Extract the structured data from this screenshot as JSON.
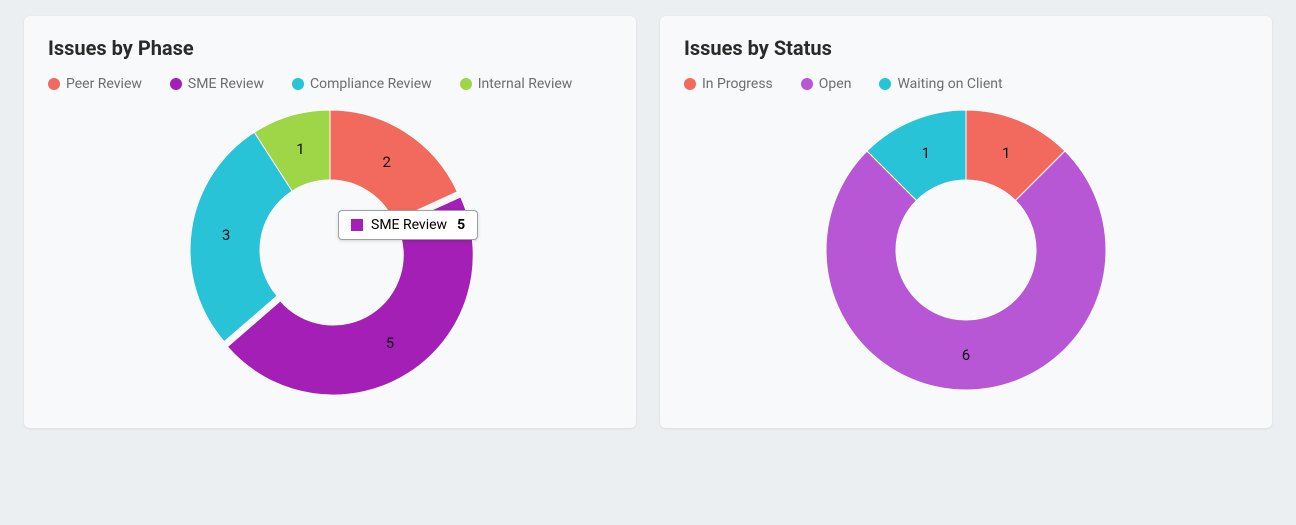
{
  "chart_data": [
    {
      "type": "pie",
      "title": "Issues by Phase",
      "series": [
        {
          "name": "Peer Review",
          "value": 2,
          "color": "#f26a5e"
        },
        {
          "name": "SME Review",
          "value": 5,
          "color": "#a31fb5"
        },
        {
          "name": "Compliance Review",
          "value": 3,
          "color": "#29c3d8"
        },
        {
          "name": "Internal Review",
          "value": 1,
          "color": "#9ed648"
        }
      ],
      "tooltip": {
        "name": "SME Review",
        "value": 5,
        "color": "#a31fb5"
      },
      "donut": true
    },
    {
      "type": "pie",
      "title": "Issues by Status",
      "series": [
        {
          "name": "In Progress",
          "value": 1,
          "color": "#f26a5e"
        },
        {
          "name": "Open",
          "value": 6,
          "color": "#b857d6"
        },
        {
          "name": "Waiting on Client",
          "value": 1,
          "color": "#29c3d8"
        }
      ],
      "donut": true
    }
  ]
}
